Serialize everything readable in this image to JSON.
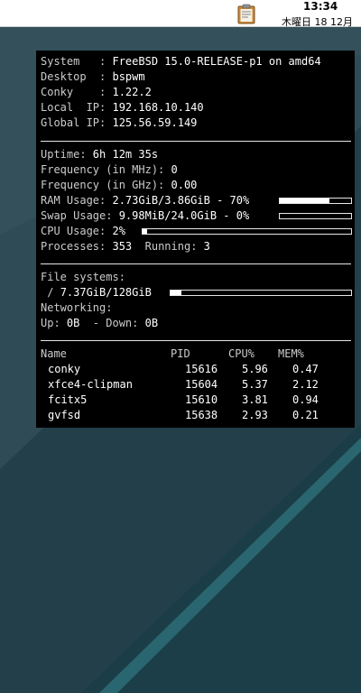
{
  "panel": {
    "time": "13:34",
    "date": "木曜日 18 12月",
    "clipboard_icon": "clipboard-icon"
  },
  "conky": {
    "system": [
      {
        "label": "System   : ",
        "value": "FreeBSD 15.0-RELEASE-p1 on amd64"
      },
      {
        "label": "Desktop  : ",
        "value": "bspwm"
      },
      {
        "label": "Conky    : ",
        "value": "1.22.2"
      },
      {
        "label": "Local  IP: ",
        "value": "192.168.10.140"
      },
      {
        "label": "Global IP: ",
        "value": "125.56.59.149"
      }
    ],
    "uptime_label": "Uptime: ",
    "uptime_value": "6h 12m 35s",
    "freq_mhz_label": "Frequency (in MHz): ",
    "freq_mhz_value": "0",
    "freq_ghz_label": "Frequency (in GHz): ",
    "freq_ghz_value": "0.00",
    "ram_label": "RAM Usage: ",
    "ram_value": "2.73GiB/3.86GiB - 70%",
    "ram_fraction": 0.7,
    "swap_label": "Swap Usage: ",
    "swap_value": "9.98MiB/24.0GiB - 0%",
    "swap_fraction": 0.0,
    "cpu_label": "CPU Usage: ",
    "cpu_value": "2%",
    "cpu_fraction": 0.02,
    "processes_label": "Processes: ",
    "processes_value": "353",
    "running_label": "  Running: ",
    "running_value": "3",
    "fs_label": "File systems:",
    "fs_root_label": " / ",
    "fs_root_value": "7.37GiB/128GiB",
    "fs_fraction": 0.06,
    "net_label": "Networking:",
    "up_label": "Up: ",
    "up_value": "0B",
    "down_label": "  - Down: ",
    "down_value": "0B",
    "proc_headers": {
      "name": "Name",
      "pid": "PID",
      "cpu": "CPU%",
      "mem": "MEM%"
    },
    "processes": [
      {
        "name": "conky",
        "pid": "15616",
        "cpu": "5.96",
        "mem": "0.47"
      },
      {
        "name": "xfce4-clipman",
        "pid": "15604",
        "cpu": "5.37",
        "mem": "2.12"
      },
      {
        "name": "fcitx5",
        "pid": "15610",
        "cpu": "3.81",
        "mem": "0.94"
      },
      {
        "name": "gvfsd",
        "pid": "15638",
        "cpu": "2.93",
        "mem": "0.21"
      }
    ]
  },
  "colors": {
    "panel_bg": "#ffffff",
    "conky_bg": "#000000",
    "text_label": "#cccccc",
    "text_value": "#ffffff",
    "desktop_dark": "#1d3d48",
    "desktop_light": "#3e5c66"
  }
}
